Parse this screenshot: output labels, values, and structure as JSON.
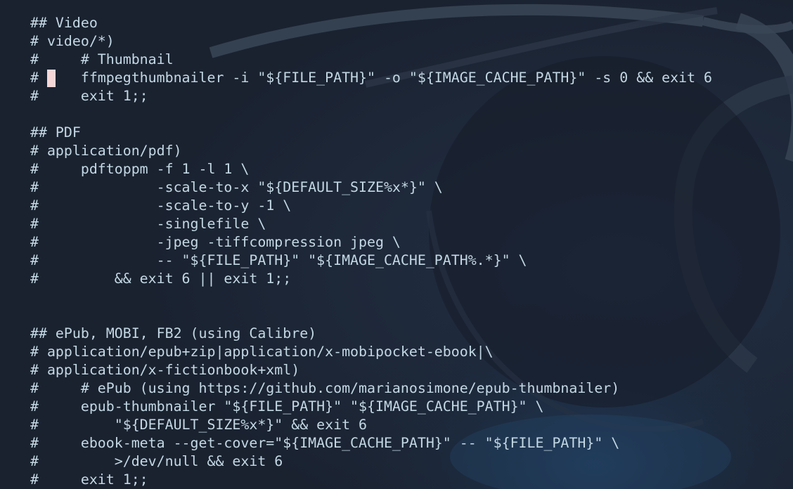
{
  "editor": {
    "lines": [
      "## Video",
      "# video/*)",
      "#     # Thumbnail",
      "#     ffmpegthumbnailer -i \"${FILE_PATH}\" -o \"${IMAGE_CACHE_PATH}\" -s 0 && exit 6",
      "#     exit 1;;",
      "",
      "## PDF",
      "# application/pdf)",
      "#     pdftoppm -f 1 -l 1 \\",
      "#              -scale-to-x \"${DEFAULT_SIZE%x*}\" \\",
      "#              -scale-to-y -1 \\",
      "#              -singlefile \\",
      "#              -jpeg -tiffcompression jpeg \\",
      "#              -- \"${FILE_PATH}\" \"${IMAGE_CACHE_PATH%.*}\" \\",
      "#         && exit 6 || exit 1;;",
      "",
      "",
      "## ePub, MOBI, FB2 (using Calibre)",
      "# application/epub+zip|application/x-mobipocket-ebook|\\",
      "# application/x-fictionbook+xml)",
      "#     # ePub (using https://github.com/marianosimone/epub-thumbnailer)",
      "#     epub-thumbnailer \"${FILE_PATH}\" \"${IMAGE_CACHE_PATH}\" \\",
      "#         \"${DEFAULT_SIZE%x*}\" && exit 6",
      "#     ebook-meta --get-cover=\"${IMAGE_CACHE_PATH}\" -- \"${FILE_PATH}\" \\",
      "#         >/dev/null && exit 6",
      "#     exit 1;;"
    ]
  },
  "colors": {
    "background": "#1a2230",
    "text": "#c4d8e4",
    "cursor": "#f5d7d8"
  }
}
